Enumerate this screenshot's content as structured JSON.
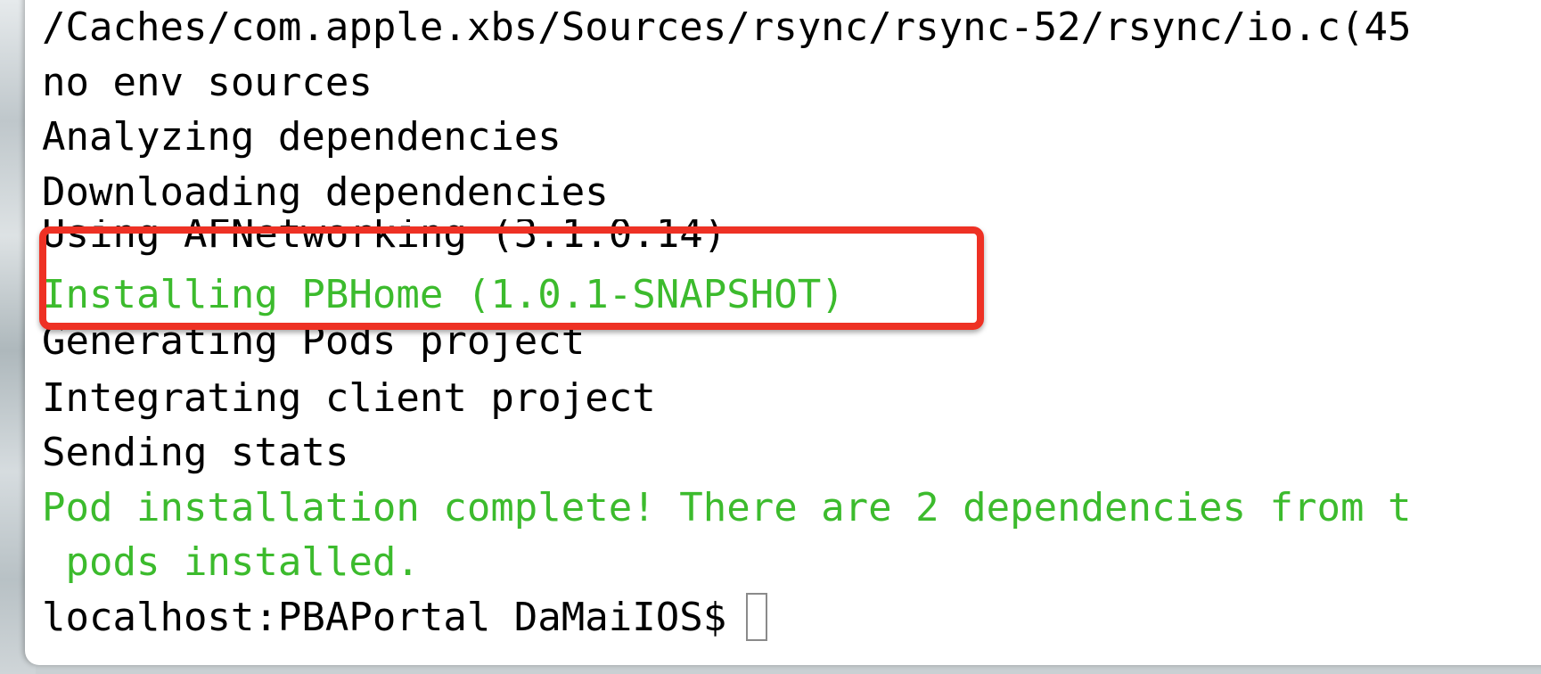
{
  "terminal": {
    "lines": [
      {
        "text": "/Caches/com.apple.xbs/Sources/rsync/rsync-52/rsync/io.c(45",
        "color": "#000000"
      },
      {
        "text": "no env sources",
        "color": "#000000"
      },
      {
        "text": "Analyzing dependencies",
        "color": "#000000"
      },
      {
        "text": "Downloading dependencies",
        "color": "#000000"
      },
      {
        "text": "Using AFNetworking (3.1.0.14)",
        "color": "#000000"
      },
      {
        "text": "Installing PBHome (1.0.1-SNAPSHOT)",
        "color": "#3cbb2d"
      },
      {
        "text": "Generating Pods project",
        "color": "#000000"
      },
      {
        "text": "Integrating client project",
        "color": "#000000"
      },
      {
        "text": "Sending stats",
        "color": "#000000"
      },
      {
        "text": "Pod installation complete! There are 2 dependencies from t",
        "color": "#3cbb2d"
      },
      {
        "text": " pods installed.",
        "color": "#3cbb2d"
      }
    ],
    "prompt": "localhost:PBAPortal DaMaiIOS$"
  },
  "annotation": {
    "highlight_color": "#ee3124"
  }
}
